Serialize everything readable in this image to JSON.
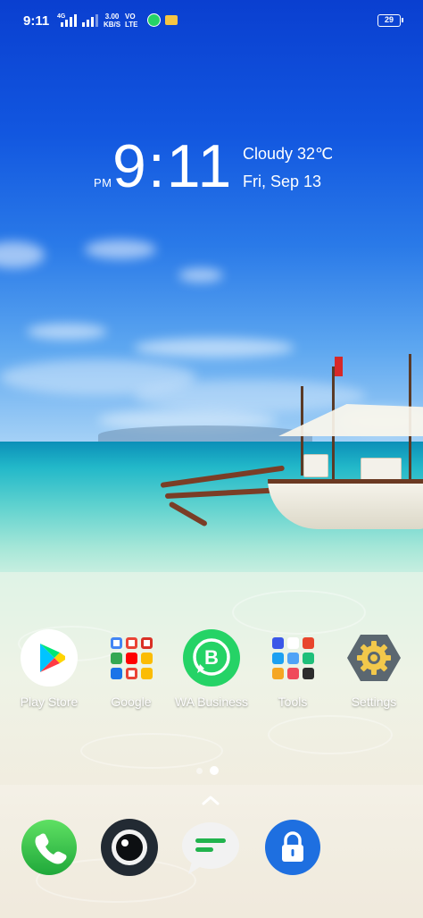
{
  "status_bar": {
    "time": "9:11",
    "network_left": "4G",
    "speed_value": "3.00",
    "speed_unit": "KB/S",
    "volte_top": "VO",
    "volte_bottom": "LTE",
    "battery_level": "29",
    "icons": [
      "signal-icon",
      "signal-icon",
      "whatsapp-icon",
      "sim-icon",
      "battery-icon"
    ]
  },
  "clock_widget": {
    "time": "9:11",
    "ampm": "PM",
    "weather": "Cloudy 32℃",
    "date": "Fri, Sep 13"
  },
  "apps": [
    {
      "label": "Play Store",
      "icon": "play-store-icon"
    },
    {
      "label": "Google",
      "icon": "folder-icon"
    },
    {
      "label": "WA Business",
      "icon": "whatsapp-business-icon"
    },
    {
      "label": "Tools",
      "icon": "folder-icon"
    },
    {
      "label": "Settings",
      "icon": "gear-icon"
    }
  ],
  "dock": [
    {
      "icon": "phone-icon"
    },
    {
      "icon": "camera-icon"
    },
    {
      "icon": "messages-icon"
    },
    {
      "icon": "lock-icon"
    }
  ],
  "page_indicator": {
    "pages": 2,
    "current": 2
  },
  "colors": {
    "whatsapp_green": "#25D366",
    "phone_green": "#3CC247",
    "camera_dark": "#222A33",
    "lock_blue": "#1E6FE0",
    "settings_gray": "#5B6770"
  }
}
